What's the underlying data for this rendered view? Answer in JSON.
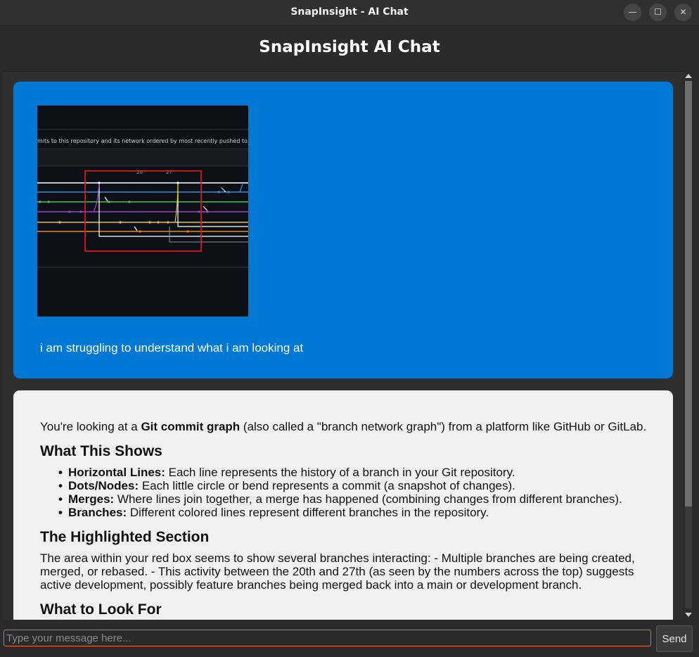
{
  "window": {
    "title": "SnapInsight - AI Chat",
    "min_glyph": "—",
    "max_glyph": "☐",
    "close_glyph": "✕"
  },
  "header": {
    "title": "SnapInsight AI Chat"
  },
  "user_message": {
    "thumbnail": {
      "caption": "mits to this repository and its network ordered by most recently pushed to.",
      "label_a": "20",
      "label_b": "27"
    },
    "text": "i am struggling to understand what i am looking at"
  },
  "bot_message": {
    "intro_before": "You're looking at a ",
    "intro_bold": "Git commit graph",
    "intro_after": " (also called a \"branch network graph\") from a platform like GitHub or GitLab.",
    "section1_title": "What This Shows",
    "bullets": [
      {
        "label": "Horizontal Lines:",
        "text": " Each line represents the history of a branch in your Git repository."
      },
      {
        "label": "Dots/Nodes:",
        "text": " Each little circle or bend represents a commit (a snapshot of changes)."
      },
      {
        "label": "Merges:",
        "text": " Where lines join together, a merge has happened (combining changes from different branches)."
      },
      {
        "label": "Branches:",
        "text": " Different colored lines represent different branches in the repository."
      }
    ],
    "section2_title": "The Highlighted Section",
    "section2_text": "The area within your red box seems to show several branches interacting: - Multiple branches are being created, merged, or rebased. - This activity between the 20th and 27th (as seen by the numbers across the top) suggests active development, possibly feature branches being merged back into a main or development branch.",
    "section3_title": "What to Look For"
  },
  "input": {
    "placeholder": "Type your message here...",
    "send_label": "Send"
  },
  "colors": {
    "user_bubble": "#0078d4",
    "bot_bubble": "#f0f0f0",
    "input_border": "#e0723a",
    "highlight_box": "#d11a1a"
  }
}
